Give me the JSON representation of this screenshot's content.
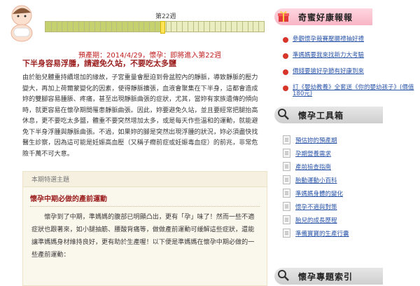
{
  "progress": {
    "week_label": "第22週",
    "current_week": 22,
    "total_weeks": 40
  },
  "due": {
    "label": "預產期：2014/4/29，懷孕：即將進入第22週"
  },
  "article": {
    "headline": "下半身容易浮腫，請避免久站，不要吃太多鹽",
    "paragraph": "由於胎兒體重持續增加的緣故，子宮重量會壓迫到骨盆腔內的靜脈，導致靜脈的壓力變大，再加上荷爾蒙變化的因素，使得靜脈擴張，血液會聚集在下半身，這都會造成妳的雙腳容易腫脹、疼痛，甚至出現靜脈曲張的症狀，尤其，當妳有家族遺傳的傾向時，就更容易在懷孕期間罹患靜脈曲張。因此，妳要避免久站，並且要經常把腿抬高休息，更不要吃太多鹽，體重不要突然增加太多，或是每天作些溫和的運動，就能避免下半身浮腫與靜脈曲張。不過，如果妳的腳是突然出現浮腫的狀況，妳必須盡快找醫生診察，因為這可能是妊娠高血壓（又稱子癇前症或妊娠毒血症）的前兆，非常危險千萬不可大意。"
  },
  "feature": {
    "header": "本期特選主題",
    "title": "懷孕中期必做的產前運動",
    "body": "懷孕到了中期，準媽媽的腹部已明顯凸出，更有「孕」味了！然而一些不適症狀也跟著來，如小腿抽筋、腰酸背痛等，做做產前運動可緩解這些症狀，還能讓準媽媽身材維持良好，更有助於生產喔！以下便是準媽媽在懷孕中期必做的一些產前運動：",
    "last": "在懷孕中期必做的一些產前運動："
  },
  "sidebar": {
    "news_title": "奇蜜好康報報",
    "news": [
      "參觀懷孕競賽壓腸禮抽好禮",
      "準媽媽要我來找新力大考驗",
      "價錢要搶好孕節有好康到來",
      "訂《嬰幼教養》全套送《你的嬰幼孩子》(價值180元)"
    ],
    "tools_title": "懷孕工具箱",
    "tools": [
      "預估妳的預產期",
      "孕期營養需求",
      "產前檢查指南",
      "胎動運動小百科",
      "準媽媽身體的變化",
      "懷孕不適與對策",
      "胎兒的成長歷程",
      "準備寶寶的生產行囊"
    ],
    "topics_title": "懷孕專題索引"
  },
  "colors": {
    "accent_red": "#9b1d1d",
    "link_blue": "#2a55a8",
    "progress_current": "#ffe45a"
  }
}
